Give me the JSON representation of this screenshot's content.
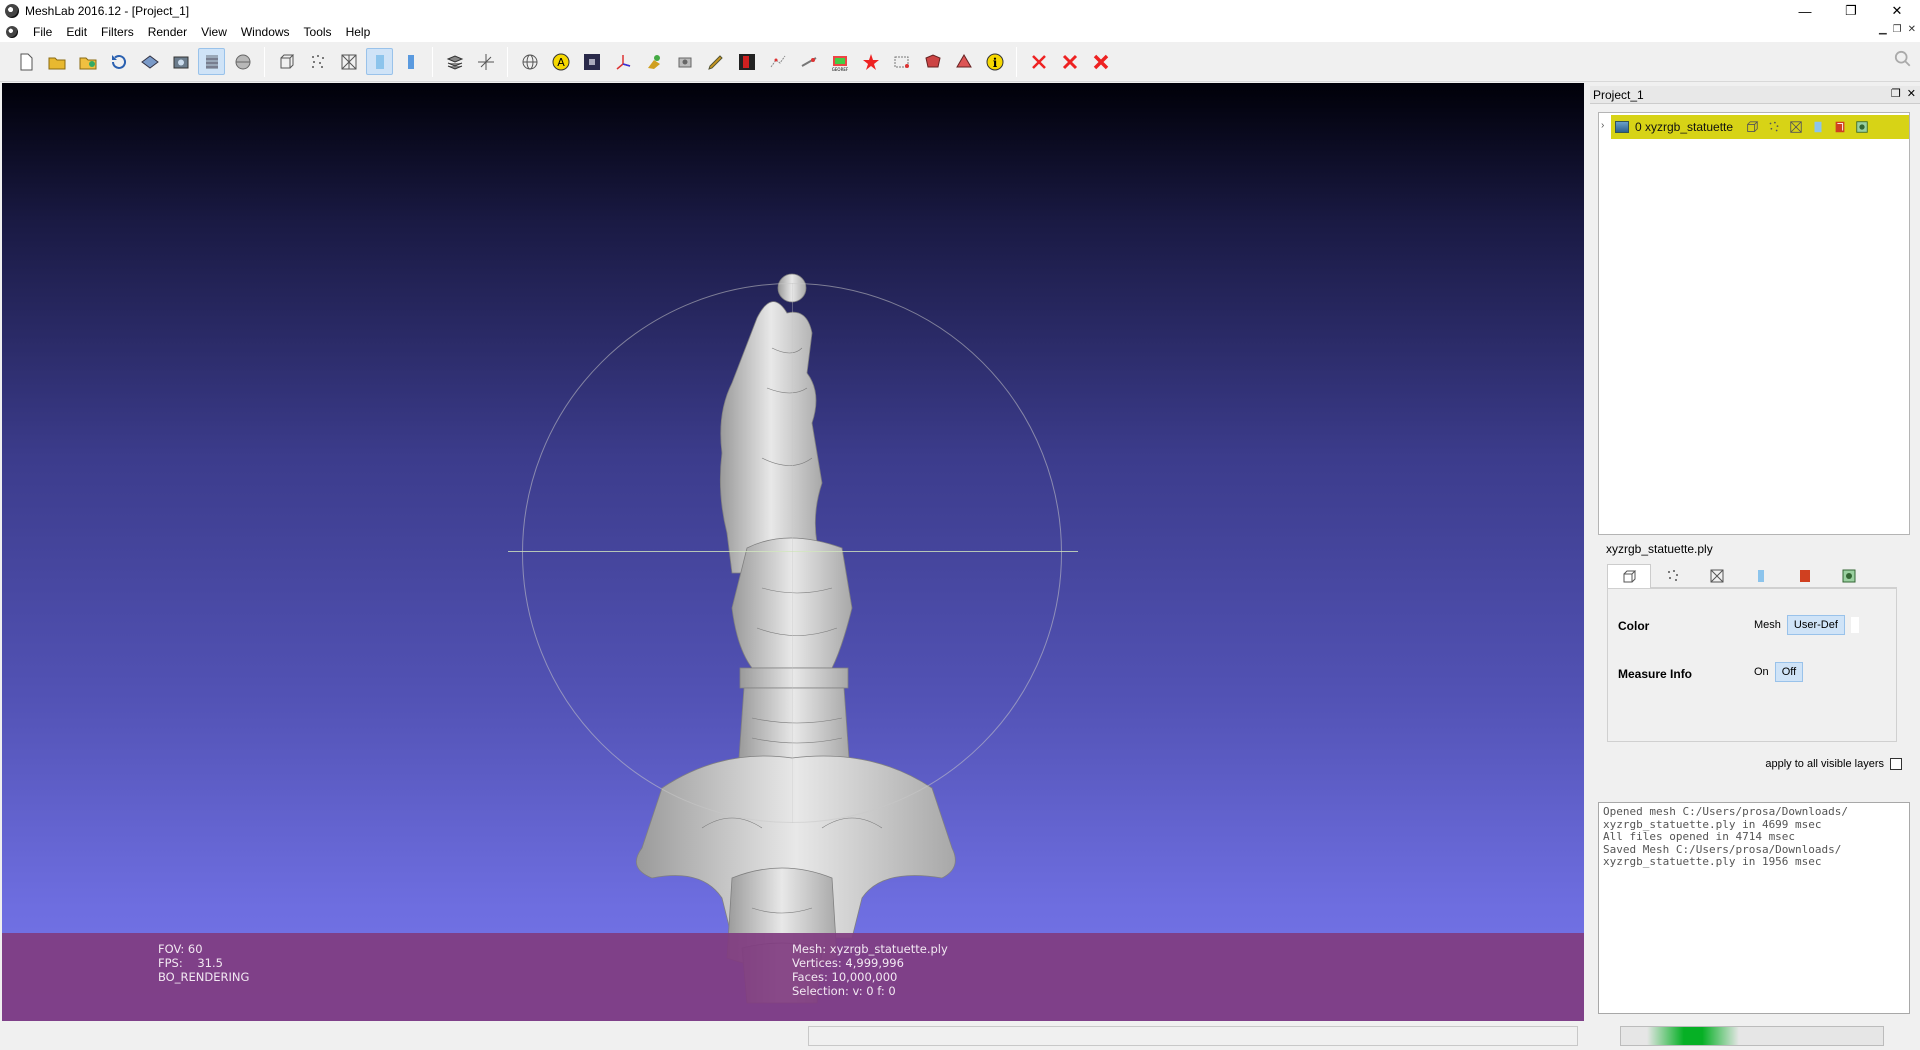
{
  "window": {
    "title": "MeshLab 2016.12 - [Project_1]",
    "controls": {
      "minimize": "—",
      "restore": "❐",
      "close": "✕"
    }
  },
  "menu": [
    "File",
    "Edit",
    "Filters",
    "Render",
    "View",
    "Windows",
    "Tools",
    "Help"
  ],
  "toolbar": {
    "icons": [
      "new-icon",
      "open-icon",
      "open-project-icon",
      "reload-icon",
      "save-icon",
      "snapshot-icon",
      "flat-lines-icon",
      "bbox-icon",
      "points-icon",
      "wireframe-icon",
      "smooth-icon",
      "flat-icon",
      "layers-icon",
      "axes-icon",
      "globe-icon",
      "annotation-icon",
      "texture-icon",
      "align-icon",
      "paint-icon",
      "brush-icon",
      "pdf-icon",
      "select-icon",
      "measure-icon",
      "georef-icon",
      "star-icon",
      "selection-rect-icon",
      "mask-icon",
      "info-icon",
      "delete-icon",
      "delete-faces-icon",
      "delete-vertices-icon"
    ]
  },
  "viewport": {
    "info_left": [
      "FOV: 60",
      "FPS:    31.5",
      "BO_RENDERING"
    ],
    "info_center": [
      "Mesh: xyzrgb_statuette.ply",
      "Vertices: 4,999,996",
      "Faces: 10,000,000",
      "Selection: v: 0 f: 0"
    ]
  },
  "dock": {
    "title": "Project_1",
    "layer": {
      "index_name": "0  xyzrgb_statuette"
    }
  },
  "props": {
    "filename": "xyzrgb_statuette.ply",
    "color_label": "Color",
    "color_mesh": "Mesh",
    "color_value": "User-Def",
    "measure_label": "Measure Info",
    "measure_on": "On",
    "measure_off": "Off",
    "apply_all": "apply to all visible layers"
  },
  "log": [
    "Opened mesh C:/Users/prosa/Downloads/",
    "xyzrgb_statuette.ply in 4699 msec",
    "All files opened in 4714 msec",
    "Saved Mesh C:/Users/prosa/Downloads/",
    "xyzrgb_statuette.ply in 1956 msec"
  ],
  "status": {
    "progress": 0.35
  },
  "colors": {
    "layer_highlight": "#d7d316",
    "overlay": "#803c80"
  }
}
